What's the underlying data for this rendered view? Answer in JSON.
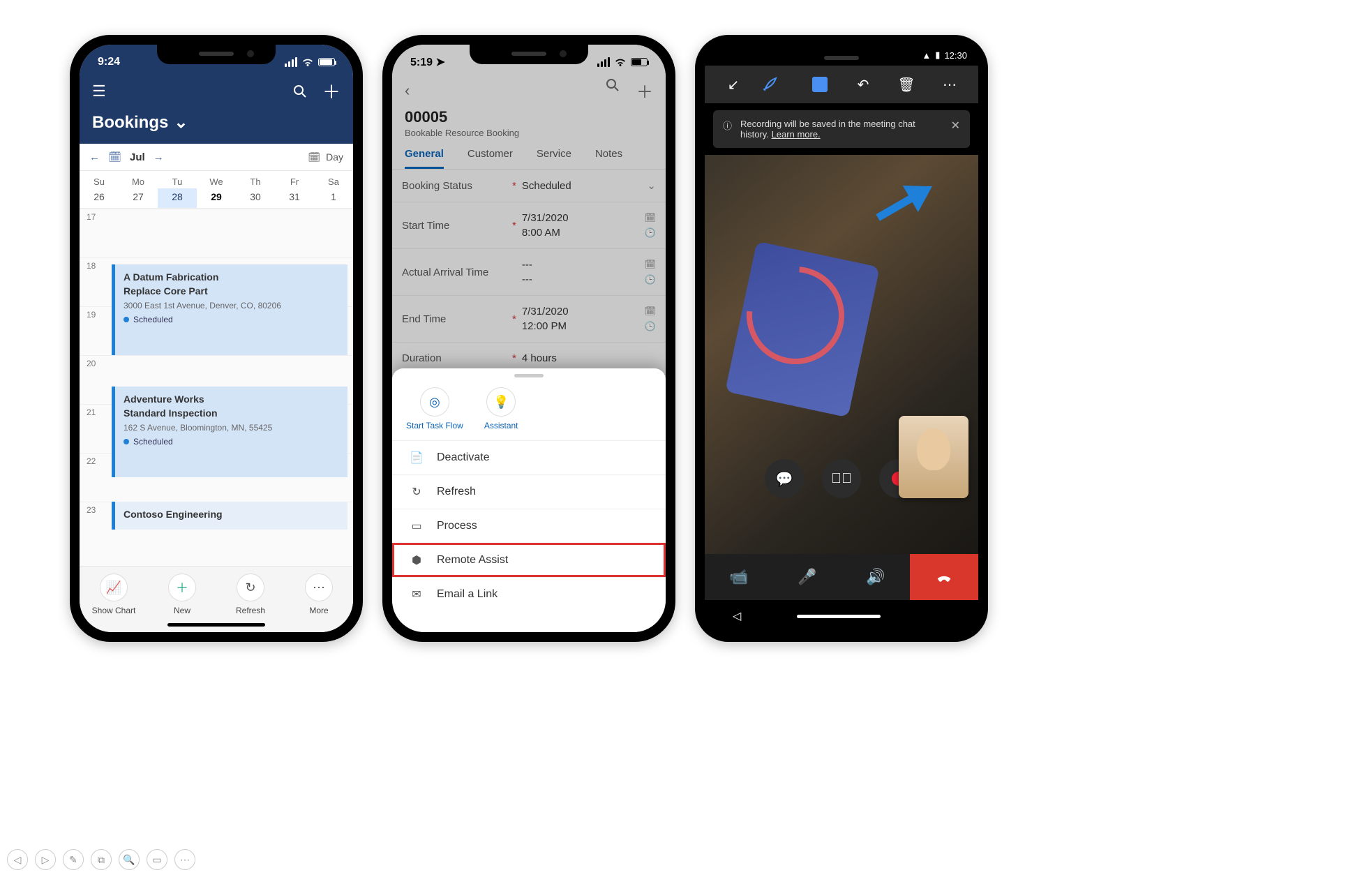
{
  "phone1": {
    "status_time": "9:24",
    "title": "Bookings",
    "month": "Jul",
    "view_label": "Day",
    "weekdays": [
      "Su",
      "Mo",
      "Tu",
      "We",
      "Th",
      "Fr",
      "Sa"
    ],
    "weeknums": [
      "26",
      "27",
      "28",
      "29",
      "30",
      "31",
      "1"
    ],
    "selected_index": 2,
    "today_index": 3,
    "hours": [
      "17",
      "18",
      "19",
      "20",
      "21",
      "22",
      "23"
    ],
    "events": [
      {
        "company": "A Datum Fabrication",
        "task": "Replace Core Part",
        "address": "3000 East 1st Avenue, Denver, CO, 80206",
        "status": "Scheduled"
      },
      {
        "company": "Adventure Works",
        "task": "Standard Inspection",
        "address": "162 S Avenue, Bloomington, MN, 55425",
        "status": "Scheduled"
      },
      {
        "company": "Contoso Engineering"
      }
    ],
    "bottom": {
      "showchart": "Show Chart",
      "new": "New",
      "refresh": "Refresh",
      "more": "More"
    }
  },
  "phone2": {
    "status_time": "5:19",
    "record_id": "00005",
    "subtitle": "Bookable Resource Booking",
    "tabs": [
      "General",
      "Customer",
      "Service",
      "Notes"
    ],
    "fields": {
      "booking_status_lbl": "Booking Status",
      "booking_status_val": "Scheduled",
      "start_lbl": "Start Time",
      "start_date": "7/31/2020",
      "start_time": "8:00 AM",
      "arrival_lbl": "Actual Arrival Time",
      "arrival_val": "---",
      "end_lbl": "End Time",
      "end_date": "7/31/2020",
      "end_time": "12:00 PM",
      "duration_lbl": "Duration",
      "duration_val": "4 hours"
    },
    "sheet": {
      "start_taskflow": "Start Task Flow",
      "assistant": "Assistant",
      "deactivate": "Deactivate",
      "refresh": "Refresh",
      "process": "Process",
      "remote_assist": "Remote Assist",
      "email_link": "Email a Link"
    }
  },
  "phone3": {
    "status_time": "12:30",
    "banner_text": "Recording will be saved in the meeting chat history.",
    "banner_link": "Learn more."
  },
  "page_tools": [
    "◁",
    "▷",
    "✎",
    "⧉",
    "🔍",
    "▭",
    "⋯"
  ]
}
